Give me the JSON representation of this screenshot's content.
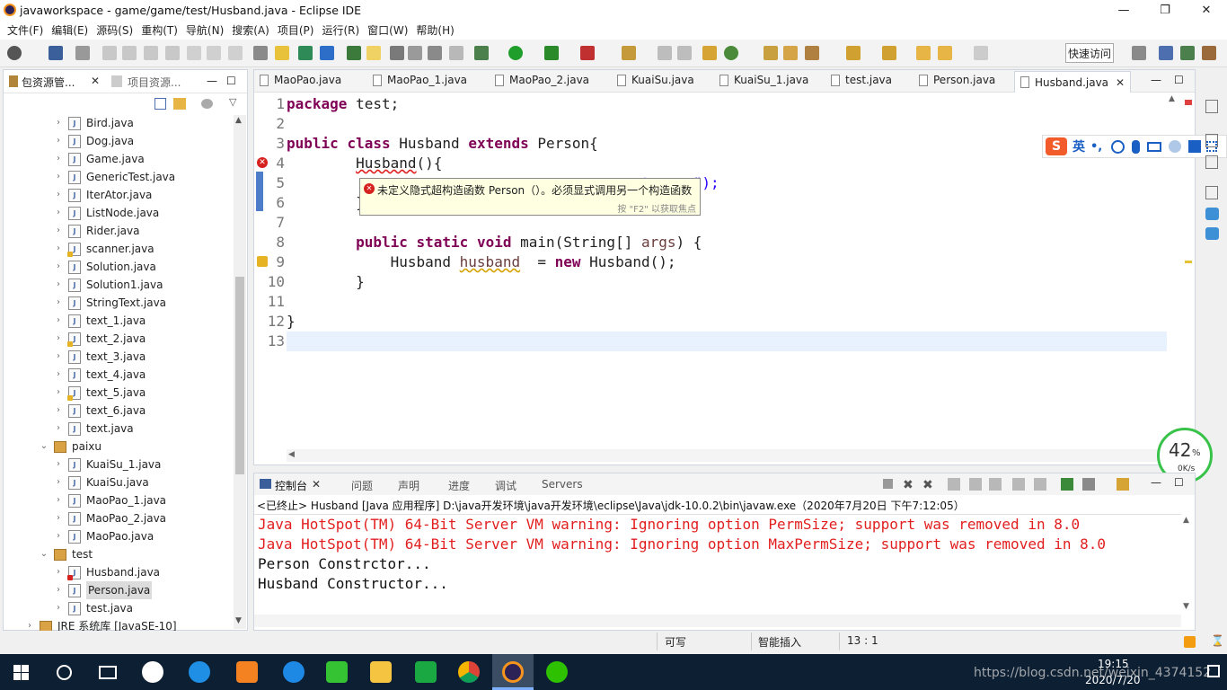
{
  "window": {
    "title": "javaworkspace - game/game/test/Husband.java - Eclipse IDE",
    "minimize": "—",
    "restore": "❐",
    "close": "✕"
  },
  "menu": [
    "文件(F)",
    "编辑(E)",
    "源码(S)",
    "重构(T)",
    "导航(N)",
    "搜索(A)",
    "项目(P)",
    "运行(R)",
    "窗口(W)",
    "帮助(H)"
  ],
  "quick_access": "快速访问",
  "left_panel": {
    "tabs": [
      "包资源管...",
      "项目资源..."
    ],
    "tree": [
      {
        "label": "Bird.java",
        "kind": "file"
      },
      {
        "label": "Dog.java",
        "kind": "file"
      },
      {
        "label": "Game.java",
        "kind": "file"
      },
      {
        "label": "GenericTest.java",
        "kind": "file"
      },
      {
        "label": "IterAtor.java",
        "kind": "file"
      },
      {
        "label": "ListNode.java",
        "kind": "file"
      },
      {
        "label": "Rider.java",
        "kind": "file"
      },
      {
        "label": "scanner.java",
        "kind": "file-warn"
      },
      {
        "label": "Solution.java",
        "kind": "file"
      },
      {
        "label": "Solution1.java",
        "kind": "file"
      },
      {
        "label": "StringText.java",
        "kind": "file"
      },
      {
        "label": "text_1.java",
        "kind": "file"
      },
      {
        "label": "text_2.java",
        "kind": "file-warn"
      },
      {
        "label": "text_3.java",
        "kind": "file"
      },
      {
        "label": "text_4.java",
        "kind": "file"
      },
      {
        "label": "text_5.java",
        "kind": "file-warn"
      },
      {
        "label": "text_6.java",
        "kind": "file"
      },
      {
        "label": "text.java",
        "kind": "file"
      },
      {
        "label": "paixu",
        "kind": "package"
      },
      {
        "label": "KuaiSu_1.java",
        "kind": "file"
      },
      {
        "label": "KuaiSu.java",
        "kind": "file"
      },
      {
        "label": "MaoPao_1.java",
        "kind": "file"
      },
      {
        "label": "MaoPao_2.java",
        "kind": "file"
      },
      {
        "label": "MaoPao.java",
        "kind": "file"
      },
      {
        "label": "test",
        "kind": "package"
      },
      {
        "label": "Husband.java",
        "kind": "file-err"
      },
      {
        "label": "Person.java",
        "kind": "file-selected"
      },
      {
        "label": "test.java",
        "kind": "file"
      },
      {
        "label": "JRE 系统库 [JavaSE-10]",
        "kind": "lib"
      }
    ]
  },
  "editor": {
    "tabs": [
      "MaoPao.java",
      "MaoPao_1.java",
      "MaoPao_2.java",
      "KuaiSu.java",
      "KuaiSu_1.java",
      "test.java",
      "Person.java",
      "Husband.java"
    ],
    "active_tab": "Husband.java",
    "line_numbers": [
      "1",
      "2",
      "3",
      "4",
      "5",
      "6",
      "7",
      "8",
      "9",
      "10",
      "11",
      "12",
      "13"
    ],
    "tooltip": {
      "message": "未定义隐式超构造函数 Person（）。必须显式调用另一个构造函数",
      "hint": "按 \"F2\" 以获取焦点"
    },
    "line5_tail": "uctor...\");"
  },
  "console": {
    "tabs": [
      "控制台",
      "问题",
      "声明",
      "进度",
      "调试",
      "Servers"
    ],
    "header": "<已终止> Husband [Java 应用程序] D:\\java开发环境\\java开发环境\\eclipse\\Java\\jdk-10.0.2\\bin\\javaw.exe（2020年7月20日 下午7:12:05）",
    "lines": [
      {
        "text": "Java HotSpot(TM) 64-Bit Server VM warning: Ignoring option PermSize; support was removed in 8.0",
        "color": "#e21f1f"
      },
      {
        "text": "Java HotSpot(TM) 64-Bit Server VM warning: Ignoring option MaxPermSize; support was removed in 8.0",
        "color": "#e21f1f"
      },
      {
        "text": "Person Constrctor...",
        "color": "#111111"
      },
      {
        "text": "Husband Constructor...",
        "color": "#111111"
      }
    ]
  },
  "status": {
    "writable": "可写",
    "insert": "智能插入",
    "position": "13 : 1"
  },
  "ime": {
    "lang": "英",
    "punct": "•,"
  },
  "speed": {
    "percent": "42",
    "unit": "%",
    "rate": "0K/s"
  },
  "taskbar": {
    "time": "19:15",
    "date": "2020/7/20",
    "watermark": "https://blog.csdn.net/weixin_4374152"
  }
}
